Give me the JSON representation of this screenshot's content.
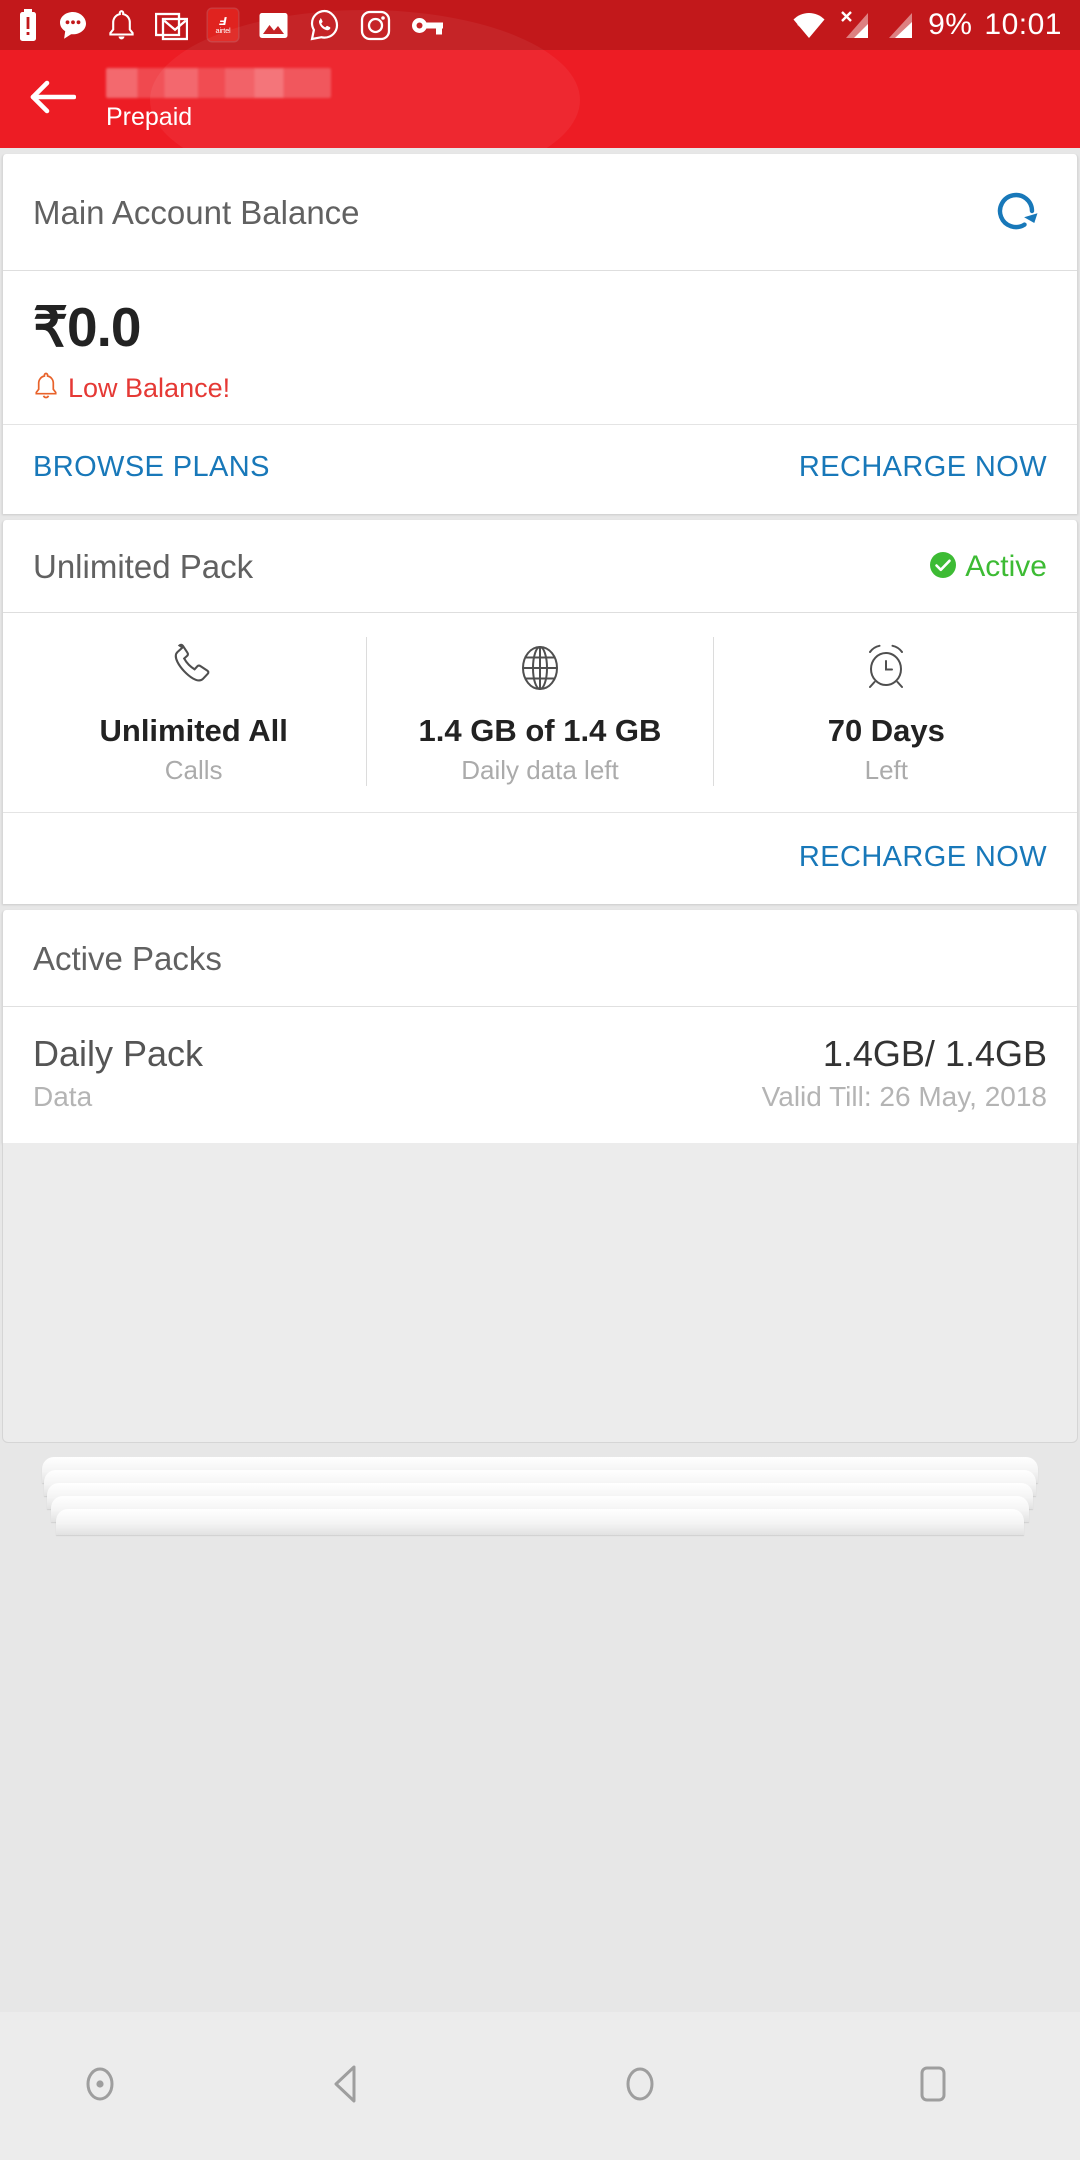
{
  "status_bar": {
    "icons": [
      "battery-alert-icon",
      "message-bubble-icon",
      "bell-icon",
      "gmail-icon",
      "airtel-icon",
      "photos-icon",
      "whatsapp-icon",
      "instagram-icon",
      "key-icon"
    ],
    "airtel_badge_label": "airtel",
    "right_icons": [
      "wifi-icon",
      "signal-no-service-icon",
      "signal-bars-icon"
    ],
    "battery_percent": "9%",
    "time": "10:01"
  },
  "app_bar": {
    "back_icon": "back-arrow-icon",
    "account_label_redacted": true,
    "plan_type": "Prepaid"
  },
  "balance_card": {
    "title": "Main Account Balance",
    "refresh_icon": "refresh-icon",
    "amount": "₹0.0",
    "alert_icon": "bell-alert-icon",
    "alert_text": "Low Balance!",
    "browse_plans_label": "BROWSE PLANS",
    "recharge_now_label": "RECHARGE NOW"
  },
  "unlimited_pack": {
    "title": "Unlimited Pack",
    "status_badge": {
      "icon": "check-circle-icon",
      "label": "Active"
    },
    "columns": [
      {
        "icon": "phone-icon",
        "value": "Unlimited All",
        "label": "Calls"
      },
      {
        "icon": "globe-icon",
        "value": "1.4 GB of 1.4 GB",
        "label": "Daily data left"
      },
      {
        "icon": "alarm-icon",
        "value": "70 Days",
        "label": "Left"
      }
    ],
    "recharge_now_label": "RECHARGE NOW"
  },
  "active_packs": {
    "title": "Active Packs",
    "rows": [
      {
        "name": "Daily Pack",
        "type": "Data",
        "value": "1.4GB/ 1.4GB",
        "validity": "Valid Till: 26 May, 2018"
      }
    ]
  },
  "nav_bar": {
    "buttons": [
      "screenshot-record-icon",
      "back-triangle-icon",
      "home-circle-icon",
      "recents-square-icon"
    ]
  },
  "colors": {
    "status_bar": "#c2181b",
    "app_bar": "#ed1c24",
    "link": "#1878b9",
    "alert_red": "#e53935",
    "active_green": "#3dbb34",
    "page_bg": "#e7e7e7"
  }
}
